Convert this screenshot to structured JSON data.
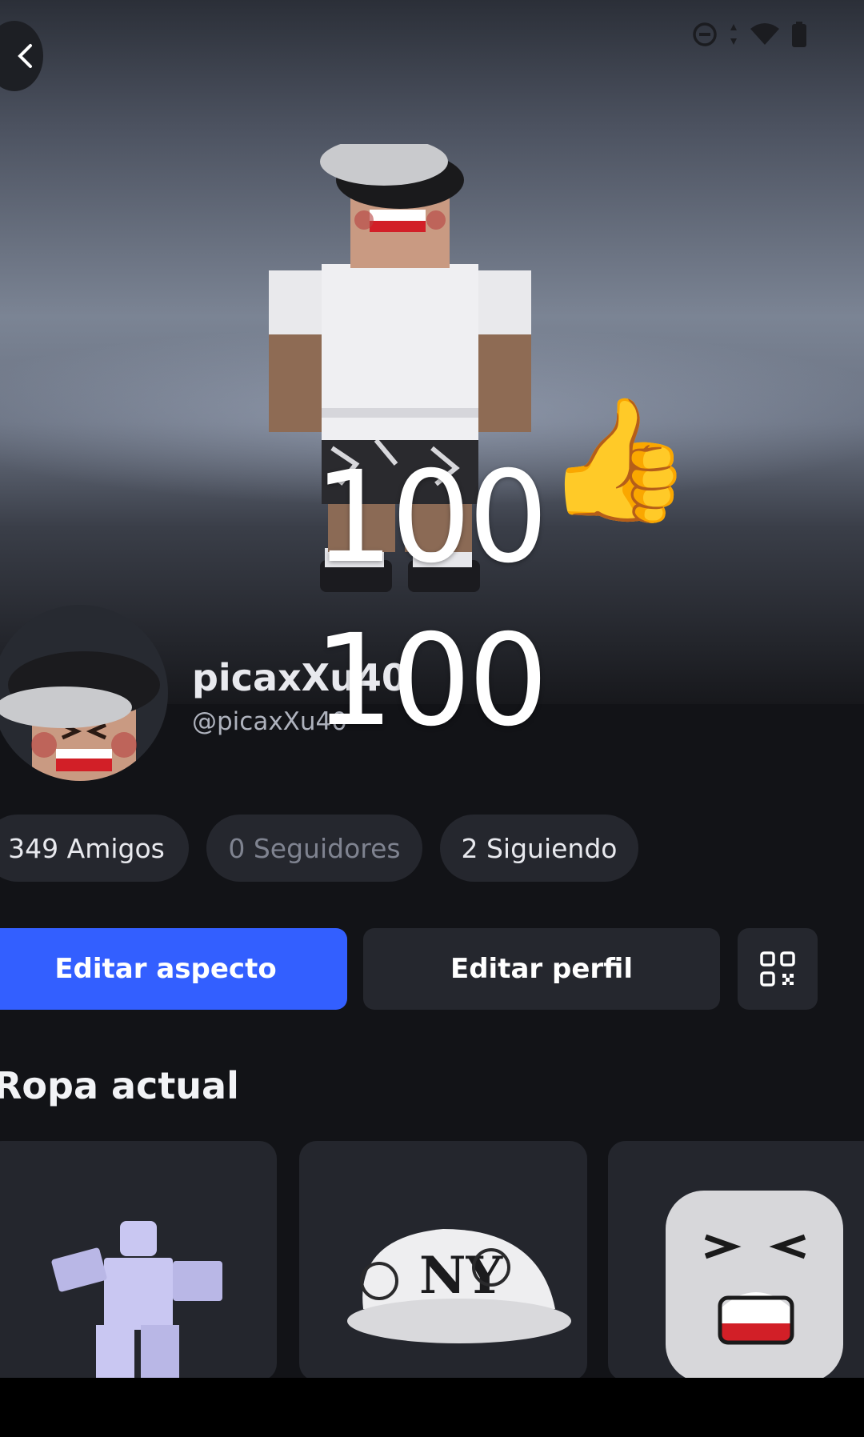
{
  "header": {
    "back_icon": "chevron-left-icon"
  },
  "status_bar": {
    "icons": [
      "dnd-icon",
      "data-arrows-icon",
      "wifi-icon",
      "battery-icon"
    ]
  },
  "overlay": {
    "number_top": "100",
    "number_bottom": "100",
    "emoji": "👍"
  },
  "profile": {
    "display_name": "picaxXu40",
    "username": "@picaxXu40"
  },
  "stats": {
    "friends": "349 Amigos",
    "followers": "0 Seguidores",
    "following": "2 Siguiendo"
  },
  "actions": {
    "edit_avatar": "Editar aspecto",
    "edit_profile": "Editar perfil",
    "qr_icon": "qr-code-icon"
  },
  "outfit": {
    "title": "Ropa actual",
    "items": [
      {
        "name": "animation-pose-item"
      },
      {
        "name": "ny-cap-item"
      },
      {
        "name": "face-item"
      }
    ]
  },
  "colors": {
    "accent": "#335fff",
    "background": "#121317",
    "surface": "#25272e"
  }
}
